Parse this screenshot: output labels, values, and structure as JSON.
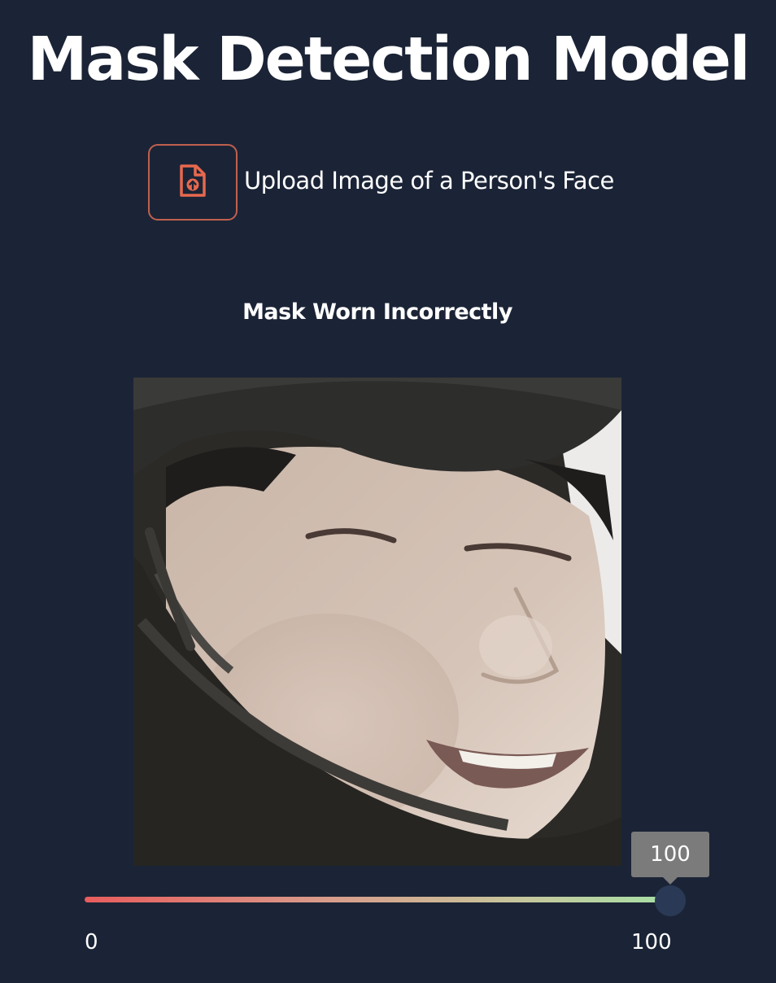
{
  "page": {
    "title": "Mask Detection Model"
  },
  "upload": {
    "label": "Upload Image of a Person's Face",
    "icon": "file-upload-icon",
    "icon_color": "#e8684e",
    "border_color": "#c0604e"
  },
  "result": {
    "label": "Mask Worn Incorrectly",
    "image_icon": "face-photo"
  },
  "slider": {
    "value": 100,
    "value_label": "100",
    "min": 0,
    "max": 100,
    "min_label": "0",
    "max_label": "100",
    "gradient_start": "#e85d5d",
    "gradient_end": "#a7e0a6"
  },
  "colors": {
    "background": "#1b2436",
    "text": "#ffffff"
  }
}
